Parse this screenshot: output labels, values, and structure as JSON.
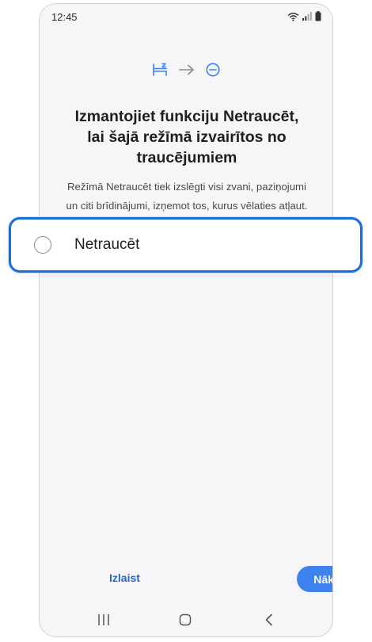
{
  "status_bar": {
    "time": "12:45",
    "icons": [
      "wifi-icon",
      "signal-icon",
      "battery-icon"
    ]
  },
  "flow_icons": [
    "bed-icon",
    "arrow-right-icon",
    "do-not-disturb-icon"
  ],
  "title_lines": [
    "Izmantojiet funkciju Netraucēt,",
    "lai šajā režīmā izvairītos no",
    "traucējumiem"
  ],
  "description_lines": [
    "Režīmā Netraucēt tiek izslēgti visi zvani, paziņojumi",
    "un citi brīdinājumi, izņemot tos, kurus vēlaties atļaut."
  ],
  "option": {
    "label": "Netraucēt",
    "selected": false
  },
  "footer": {
    "skip_label": "Izlaist",
    "next_label": "Nāk."
  },
  "nav_bar": [
    "recent-apps-icon",
    "home-icon",
    "back-icon"
  ],
  "colors": {
    "accent": "#3e82f0",
    "link": "#2a64c4",
    "highlight": "#1a6fd4"
  }
}
